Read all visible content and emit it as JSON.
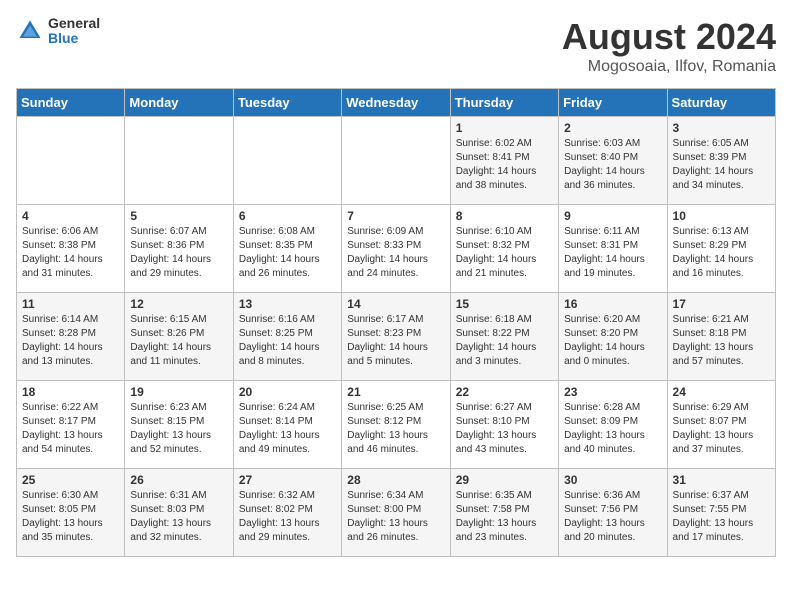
{
  "logo": {
    "general": "General",
    "blue": "Blue"
  },
  "title": "August 2024",
  "subtitle": "Mogosoaia, Ilfov, Romania",
  "weekdays": [
    "Sunday",
    "Monday",
    "Tuesday",
    "Wednesday",
    "Thursday",
    "Friday",
    "Saturday"
  ],
  "weeks": [
    [
      {
        "day": "",
        "content": ""
      },
      {
        "day": "",
        "content": ""
      },
      {
        "day": "",
        "content": ""
      },
      {
        "day": "",
        "content": ""
      },
      {
        "day": "1",
        "content": "Sunrise: 6:02 AM\nSunset: 8:41 PM\nDaylight: 14 hours\nand 38 minutes."
      },
      {
        "day": "2",
        "content": "Sunrise: 6:03 AM\nSunset: 8:40 PM\nDaylight: 14 hours\nand 36 minutes."
      },
      {
        "day": "3",
        "content": "Sunrise: 6:05 AM\nSunset: 8:39 PM\nDaylight: 14 hours\nand 34 minutes."
      }
    ],
    [
      {
        "day": "4",
        "content": "Sunrise: 6:06 AM\nSunset: 8:38 PM\nDaylight: 14 hours\nand 31 minutes."
      },
      {
        "day": "5",
        "content": "Sunrise: 6:07 AM\nSunset: 8:36 PM\nDaylight: 14 hours\nand 29 minutes."
      },
      {
        "day": "6",
        "content": "Sunrise: 6:08 AM\nSunset: 8:35 PM\nDaylight: 14 hours\nand 26 minutes."
      },
      {
        "day": "7",
        "content": "Sunrise: 6:09 AM\nSunset: 8:33 PM\nDaylight: 14 hours\nand 24 minutes."
      },
      {
        "day": "8",
        "content": "Sunrise: 6:10 AM\nSunset: 8:32 PM\nDaylight: 14 hours\nand 21 minutes."
      },
      {
        "day": "9",
        "content": "Sunrise: 6:11 AM\nSunset: 8:31 PM\nDaylight: 14 hours\nand 19 minutes."
      },
      {
        "day": "10",
        "content": "Sunrise: 6:13 AM\nSunset: 8:29 PM\nDaylight: 14 hours\nand 16 minutes."
      }
    ],
    [
      {
        "day": "11",
        "content": "Sunrise: 6:14 AM\nSunset: 8:28 PM\nDaylight: 14 hours\nand 13 minutes."
      },
      {
        "day": "12",
        "content": "Sunrise: 6:15 AM\nSunset: 8:26 PM\nDaylight: 14 hours\nand 11 minutes."
      },
      {
        "day": "13",
        "content": "Sunrise: 6:16 AM\nSunset: 8:25 PM\nDaylight: 14 hours\nand 8 minutes."
      },
      {
        "day": "14",
        "content": "Sunrise: 6:17 AM\nSunset: 8:23 PM\nDaylight: 14 hours\nand 5 minutes."
      },
      {
        "day": "15",
        "content": "Sunrise: 6:18 AM\nSunset: 8:22 PM\nDaylight: 14 hours\nand 3 minutes."
      },
      {
        "day": "16",
        "content": "Sunrise: 6:20 AM\nSunset: 8:20 PM\nDaylight: 14 hours\nand 0 minutes."
      },
      {
        "day": "17",
        "content": "Sunrise: 6:21 AM\nSunset: 8:18 PM\nDaylight: 13 hours\nand 57 minutes."
      }
    ],
    [
      {
        "day": "18",
        "content": "Sunrise: 6:22 AM\nSunset: 8:17 PM\nDaylight: 13 hours\nand 54 minutes."
      },
      {
        "day": "19",
        "content": "Sunrise: 6:23 AM\nSunset: 8:15 PM\nDaylight: 13 hours\nand 52 minutes."
      },
      {
        "day": "20",
        "content": "Sunrise: 6:24 AM\nSunset: 8:14 PM\nDaylight: 13 hours\nand 49 minutes."
      },
      {
        "day": "21",
        "content": "Sunrise: 6:25 AM\nSunset: 8:12 PM\nDaylight: 13 hours\nand 46 minutes."
      },
      {
        "day": "22",
        "content": "Sunrise: 6:27 AM\nSunset: 8:10 PM\nDaylight: 13 hours\nand 43 minutes."
      },
      {
        "day": "23",
        "content": "Sunrise: 6:28 AM\nSunset: 8:09 PM\nDaylight: 13 hours\nand 40 minutes."
      },
      {
        "day": "24",
        "content": "Sunrise: 6:29 AM\nSunset: 8:07 PM\nDaylight: 13 hours\nand 37 minutes."
      }
    ],
    [
      {
        "day": "25",
        "content": "Sunrise: 6:30 AM\nSunset: 8:05 PM\nDaylight: 13 hours\nand 35 minutes."
      },
      {
        "day": "26",
        "content": "Sunrise: 6:31 AM\nSunset: 8:03 PM\nDaylight: 13 hours\nand 32 minutes."
      },
      {
        "day": "27",
        "content": "Sunrise: 6:32 AM\nSunset: 8:02 PM\nDaylight: 13 hours\nand 29 minutes."
      },
      {
        "day": "28",
        "content": "Sunrise: 6:34 AM\nSunset: 8:00 PM\nDaylight: 13 hours\nand 26 minutes."
      },
      {
        "day": "29",
        "content": "Sunrise: 6:35 AM\nSunset: 7:58 PM\nDaylight: 13 hours\nand 23 minutes."
      },
      {
        "day": "30",
        "content": "Sunrise: 6:36 AM\nSunset: 7:56 PM\nDaylight: 13 hours\nand 20 minutes."
      },
      {
        "day": "31",
        "content": "Sunrise: 6:37 AM\nSunset: 7:55 PM\nDaylight: 13 hours\nand 17 minutes."
      }
    ]
  ]
}
